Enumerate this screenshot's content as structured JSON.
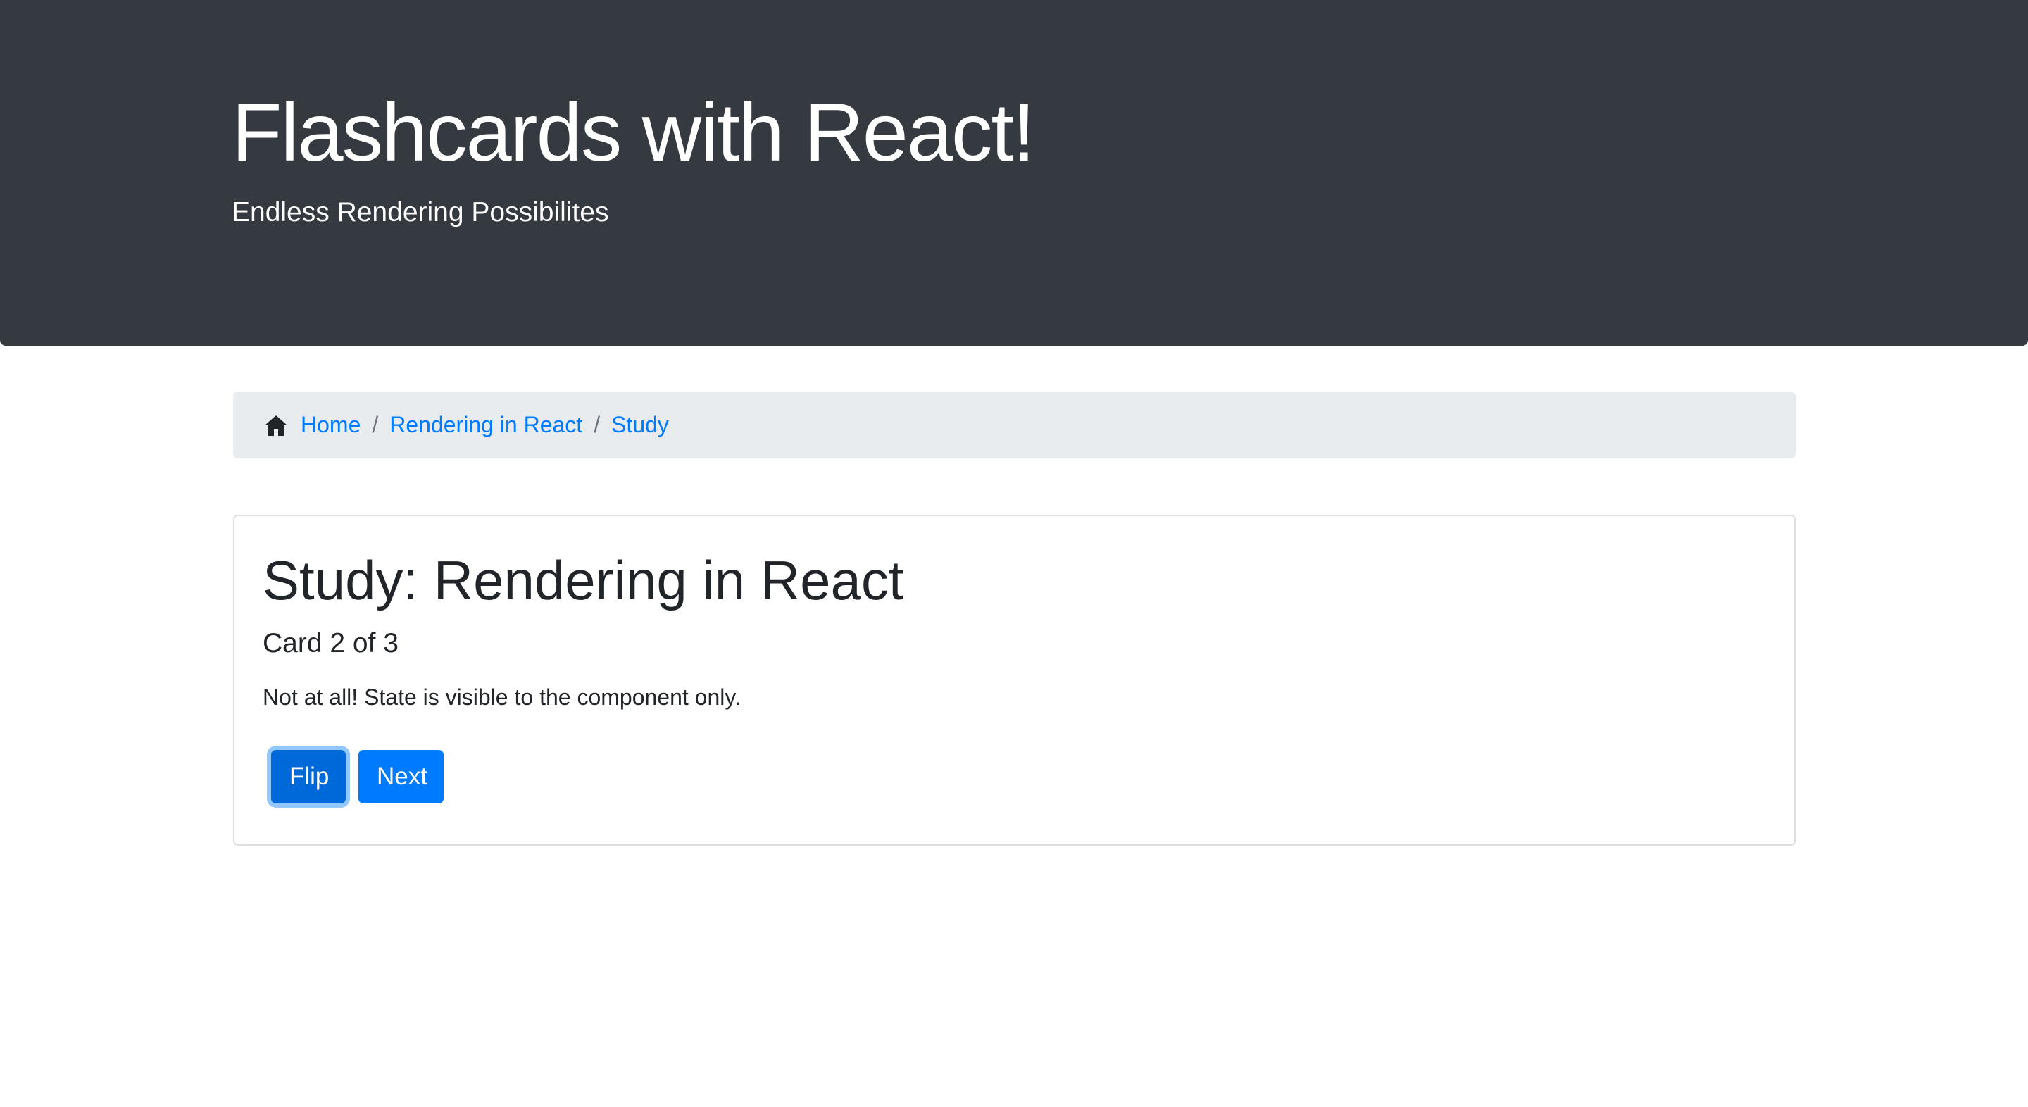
{
  "header": {
    "title": "Flashcards with React!",
    "subtitle": "Endless Rendering Possibilites"
  },
  "breadcrumb": {
    "icon": "home-icon",
    "items": [
      {
        "label": "Home"
      },
      {
        "label": "Rendering in React"
      },
      {
        "label": "Study"
      }
    ],
    "separator": "/"
  },
  "study": {
    "title": "Study: Rendering in React",
    "card_counter": "Card 2 of 3",
    "card_text": "Not at all! State is visible to the component only.",
    "flip_label": "Flip",
    "next_label": "Next"
  },
  "colors": {
    "header_bg": "#343a40",
    "link": "#007bff",
    "button": "#007bff",
    "button_active": "#0069d9",
    "breadcrumb_bg": "#e9ecef"
  }
}
